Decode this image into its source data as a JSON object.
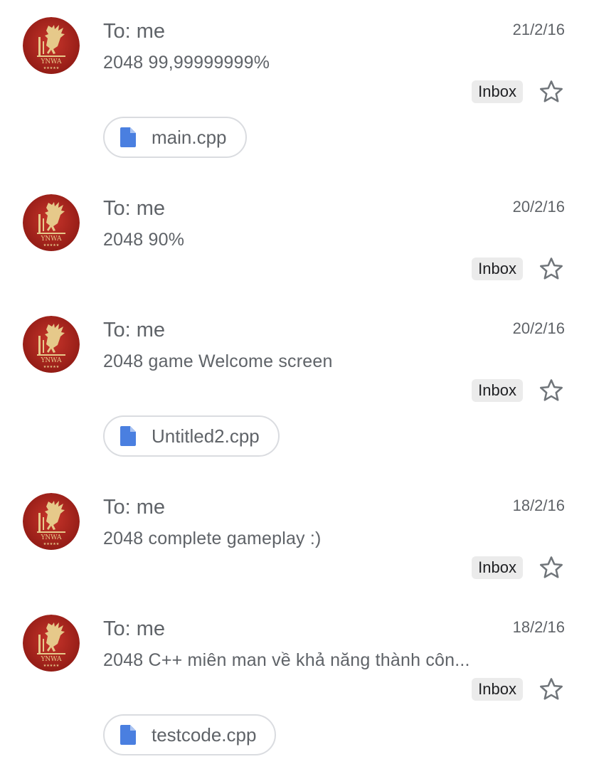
{
  "colors": {
    "avatar_red": "#b5261e",
    "avatar_gold": "#e6c98a",
    "file_icon_blue": "#4a7fe0",
    "badge_bg": "#ebebeb",
    "text_gray": "#5f6368"
  },
  "icons": {
    "avatar": "liverbird-ynwa-crest",
    "attachment": "document-file-icon",
    "star": "star-outline-icon"
  },
  "emails": [
    {
      "recipient": "To: me",
      "date": "21/2/16",
      "subject": "2048 99,99999999%",
      "label": "Inbox",
      "attachment": "main.cpp"
    },
    {
      "recipient": "To: me",
      "date": "20/2/16",
      "subject": "2048 90%",
      "label": "Inbox",
      "attachment": null
    },
    {
      "recipient": "To: me",
      "date": "20/2/16",
      "subject": "2048 game Welcome screen",
      "label": "Inbox",
      "attachment": "Untitled2.cpp"
    },
    {
      "recipient": "To: me",
      "date": "18/2/16",
      "subject": "2048 complete gameplay :)",
      "label": "Inbox",
      "attachment": null
    },
    {
      "recipient": "To: me",
      "date": "18/2/16",
      "subject": "2048 C++ miên man về khả năng thành côn...",
      "label": "Inbox",
      "attachment": "testcode.cpp"
    }
  ]
}
